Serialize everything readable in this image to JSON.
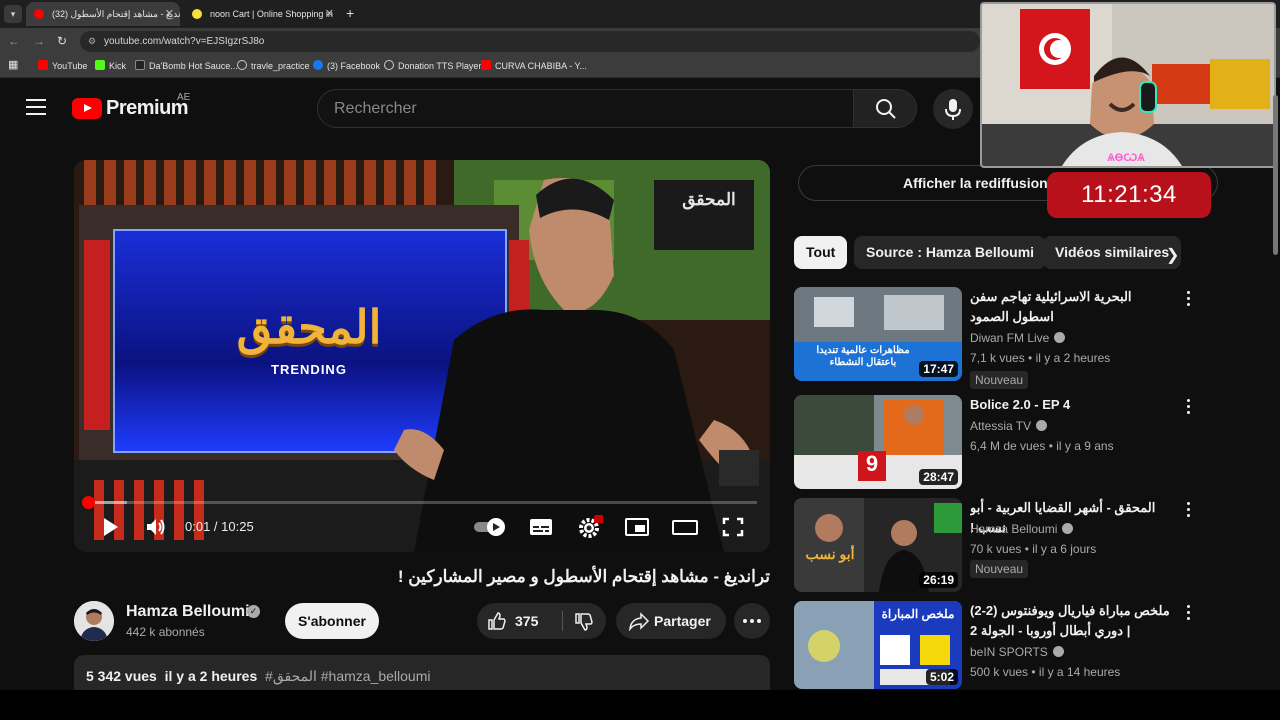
{
  "browser": {
    "tabs": [
      {
        "label": "(32) ترانديغ - مشاهد إقتحام الأسطول",
        "active": true
      },
      {
        "label": "noon Cart | Online Shopping in",
        "active": false
      }
    ],
    "url": "youtube.com/watch?v=EJSIgzrSJ8o",
    "bookmarks": [
      "YouTube",
      "Kick",
      "Da'Bomb Hot Sauce...",
      "travle_practice",
      "(3) Facebook",
      "Donation TTS Player",
      "CURVA CHABIBA - Y..."
    ]
  },
  "header": {
    "logo_word": "Premium",
    "country": "AE",
    "search_placeholder": "Rechercher"
  },
  "player": {
    "time": "0:01 / 10:25",
    "progress_fraction": 0.0016,
    "buffered_fraction": 0.06,
    "thumbnail": {
      "channel_mark": "المحقق",
      "show_title": "المحقق",
      "show_subtitle": "TRENDING"
    }
  },
  "video": {
    "title": "ترانديغ - مشاهد إقتحام الأسطول و مصير المشاركين !",
    "channel": "Hamza Belloumi",
    "subscribers": "442 k abonnés",
    "subscribe_label": "S'abonner",
    "likes": "375",
    "share_label": "Partager",
    "views": "5 342 vues",
    "age": "il y a 2 heures",
    "tags": "#المحقق #hamza_belloumi"
  },
  "sidebar": {
    "replay_label": "Afficher la rediffusion du chat",
    "chips": [
      "Tout",
      "Source : Hamza Belloumi",
      "Vidéos similaires"
    ],
    "recommendations": [
      {
        "title": "البحرية الاسرائيلية تهاجم سفن اسطول الصمود",
        "channel": "Diwan FM Live",
        "verified": true,
        "meta": "7,1 k vues • il y a 2 heures",
        "duration": "17:47",
        "badge": "Nouveau",
        "rtl": true,
        "thumb_caption": "مظاهرات عالمية تنديدا باعتقال النشطاء"
      },
      {
        "title": "Bolice 2.0 - EP 4",
        "channel": "Attessia TV",
        "verified": true,
        "meta": "6,4 M de vues • il y a 9 ans",
        "duration": "28:47",
        "badge": "",
        "rtl": false,
        "thumb_caption": "9"
      },
      {
        "title": "المحقق - أشهر القضايا العربية - أبو نسب !",
        "channel": "Hamza Belloumi",
        "verified": true,
        "meta": "70 k vues • il y a 6 jours",
        "duration": "26:19",
        "badge": "Nouveau",
        "rtl": true,
        "thumb_caption": "أبو نسب"
      },
      {
        "title": "ملخص مباراة فياريال ويوفنتوس (2-2) | دوري أبطال أوروبا - الجولة 2",
        "channel": "beIN SPORTS",
        "verified": true,
        "meta": "500 k vues • il y a 14 heures",
        "duration": "5:02",
        "badge": "",
        "rtl": true,
        "thumb_caption": "ملخص المباراة"
      }
    ]
  },
  "overlay": {
    "clock": "11:21:34",
    "cam_caption": "ѦѲѠѦ"
  },
  "colors": {
    "background": "#0f0f0f",
    "accent": "#ff0000",
    "clock_bg": "#b8111c"
  }
}
